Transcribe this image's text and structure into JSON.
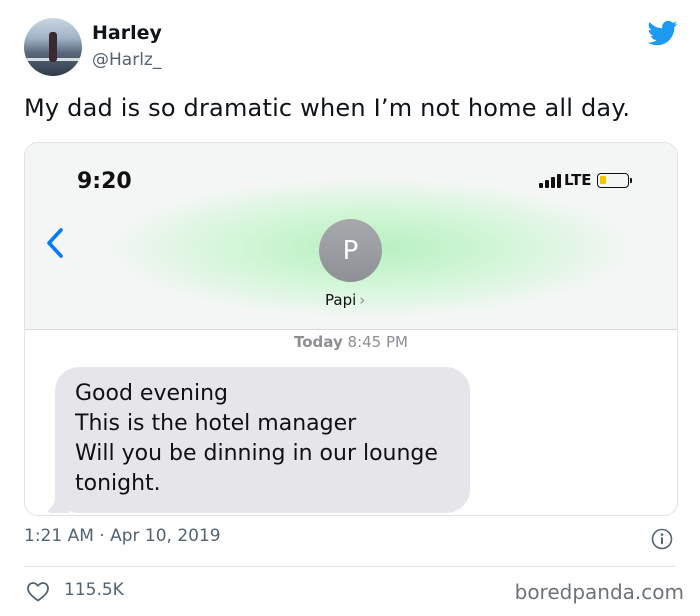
{
  "author": {
    "name": "Harley",
    "handle": "@Harlz_"
  },
  "tweet": {
    "text": "My dad is so dramatic when I’m not home all day.",
    "timestamp": "1:21 AM · Apr 10, 2019",
    "likes": "115.5K"
  },
  "screenshot": {
    "time": "9:20",
    "network": "LTE",
    "contact": {
      "initial": "P",
      "name": "Papi",
      "chevron": "›"
    },
    "message_time_day": "Today",
    "message_time_clock": "8:45 PM",
    "message_lines": [
      "Good evening",
      "This is the hotel manager",
      "Will you be dinning in our lounge",
      "tonight."
    ],
    "battery_color": "#f5c400",
    "bubble_color": "#e5e5ea"
  },
  "watermark": "boredpanda.com",
  "colors": {
    "twitter_blue": "#1d9bf0",
    "ios_blue": "#007aff"
  },
  "icons": [
    "twitter-bird-icon",
    "back-chevron-icon",
    "info-icon",
    "heart-icon",
    "signal-icon",
    "battery-icon"
  ]
}
